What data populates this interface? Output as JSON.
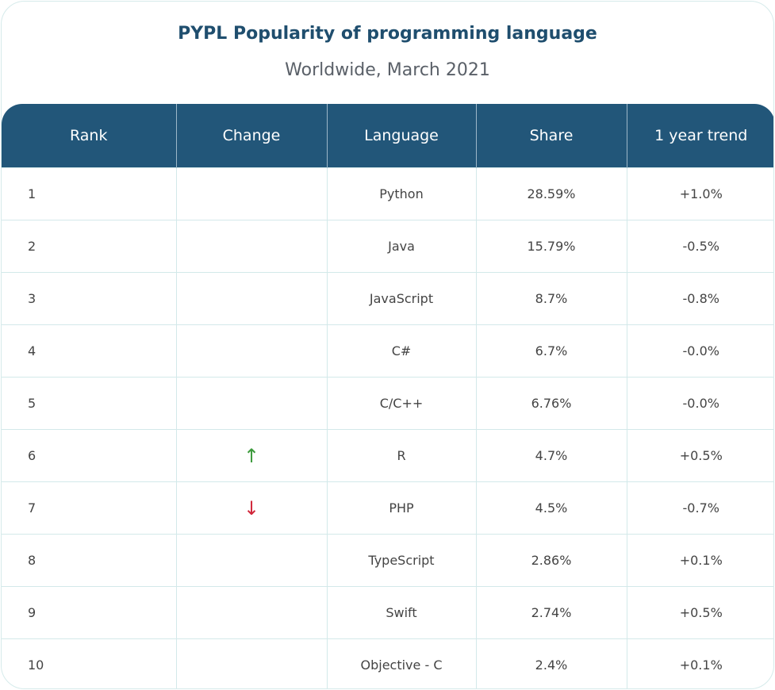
{
  "chart_data": {
    "type": "table",
    "title": "PYPL Popularity of programming language",
    "subtitle": "Worldwide, March 2021",
    "columns": [
      "Rank",
      "Change",
      "Language",
      "Share",
      "1 year trend"
    ],
    "rows": [
      {
        "rank": "1",
        "change": "",
        "language": "Python",
        "share": "28.59%",
        "trend": "+1.0%"
      },
      {
        "rank": "2",
        "change": "",
        "language": "Java",
        "share": "15.79%",
        "trend": "-0.5%"
      },
      {
        "rank": "3",
        "change": "",
        "language": "JavaScript",
        "share": "8.7%",
        "trend": "-0.8%"
      },
      {
        "rank": "4",
        "change": "",
        "language": "C#",
        "share": "6.7%",
        "trend": "-0.0%"
      },
      {
        "rank": "5",
        "change": "",
        "language": "C/C++",
        "share": "6.76%",
        "trend": "-0.0%"
      },
      {
        "rank": "6",
        "change": "up",
        "language": "R",
        "share": "4.7%",
        "trend": "+0.5%"
      },
      {
        "rank": "7",
        "change": "down",
        "language": "PHP",
        "share": "4.5%",
        "trend": "-0.7%"
      },
      {
        "rank": "8",
        "change": "",
        "language": "TypeScript",
        "share": "2.86%",
        "trend": "+0.1%"
      },
      {
        "rank": "9",
        "change": "",
        "language": "Swift",
        "share": "2.74%",
        "trend": "+0.5%"
      },
      {
        "rank": "10",
        "change": "",
        "language": "Objective - C",
        "share": "2.4%",
        "trend": "+0.1%"
      }
    ],
    "colors": {
      "header": "#225679",
      "title": "#1f4e6e",
      "up": "#3c9a3c",
      "down": "#d0263a"
    }
  }
}
